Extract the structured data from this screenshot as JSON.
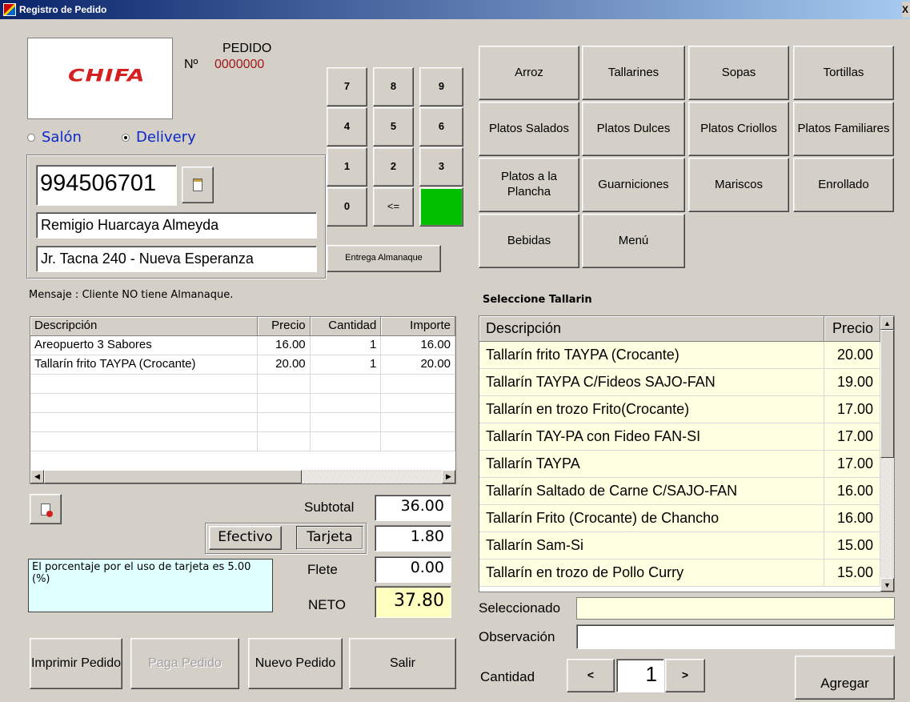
{
  "window": {
    "title": "Registro de Pedido",
    "close": "X"
  },
  "logo": {
    "text": "CHIFA"
  },
  "order": {
    "label": "PEDIDO",
    "number_label": "Nº",
    "number": "0000000"
  },
  "mode": {
    "salon": "Salón",
    "delivery": "Delivery",
    "selected": "delivery"
  },
  "customer": {
    "phone": "994506701",
    "name": "Remigio Huarcaya Almeyda",
    "address": "Jr. Tacna 240 - Nueva Esperanza"
  },
  "keypad": [
    "7",
    "8",
    "9",
    "4",
    "5",
    "6",
    "1",
    "2",
    "3",
    "0",
    "<="
  ],
  "keypad_ok_color": "#00c000",
  "entrega_button": "Entrega Almanaque",
  "message": "Mensaje : Cliente NO tiene Almanaque.",
  "order_table": {
    "headers": [
      "Descripción",
      "Precio",
      "Cantidad",
      "Importe"
    ],
    "rows": [
      [
        "Areopuerto 3 Sabores",
        "16.00",
        "1",
        "16.00"
      ],
      [
        "Tallarín frito TAYPA (Crocante)",
        "20.00",
        "1",
        "20.00"
      ]
    ]
  },
  "totals": {
    "subtotal_label": "Subtotal",
    "subtotal": "36.00",
    "efectivo": "Efectivo",
    "tarjeta": "Tarjeta",
    "tarjeta_amount": "1.80",
    "flete_label": "Flete",
    "flete": "0.00",
    "neto_label": "NETO",
    "neto": "37.80"
  },
  "card_info": "El porcentaje por el uso de tarjeta es 5.00 (%)",
  "bottom_buttons": {
    "imprimir": "Imprimir Pedido",
    "paga": "Paga Pedido",
    "nuevo": "Nuevo Pedido",
    "salir": "Salir"
  },
  "categories": [
    "Arroz",
    "Tallarines",
    "Sopas",
    "Tortillas",
    "Platos Salados",
    "Platos Dulces",
    "Platos Criollos",
    "Platos Familiares",
    "Platos a la Plancha",
    "Guarniciones",
    "Mariscos",
    "Enrollado",
    "Bebidas",
    "Menú"
  ],
  "selection_title": "Seleccione Tallarin",
  "menu_table": {
    "headers": [
      "Descripción",
      "Precio"
    ],
    "rows": [
      [
        "Tallarín frito TAYPA (Crocante)",
        "20.00"
      ],
      [
        "Tallarín TAYPA C/Fideos SAJO-FAN",
        "19.00"
      ],
      [
        "Tallarín en trozo Frito(Crocante)",
        "17.00"
      ],
      [
        "Tallarín TAY-PA con Fideo FAN-SI",
        "17.00"
      ],
      [
        "Tallarín TAYPA",
        "17.00"
      ],
      [
        "Tallarín Saltado de Carne C/SAJO-FAN",
        "16.00"
      ],
      [
        "Tallarín Frito (Crocante) de Chancho",
        "16.00"
      ],
      [
        "Tallarín Sam-Si",
        "15.00"
      ],
      [
        "Tallarín en trozo de Pollo Curry",
        "15.00"
      ]
    ]
  },
  "form": {
    "seleccionado_label": "Seleccionado",
    "seleccionado": "",
    "observacion_label": "Observación",
    "observacion": "",
    "cantidad_label": "Cantidad",
    "cantidad": "1",
    "dec": "<",
    "inc": ">",
    "agregar": "Agregar"
  }
}
